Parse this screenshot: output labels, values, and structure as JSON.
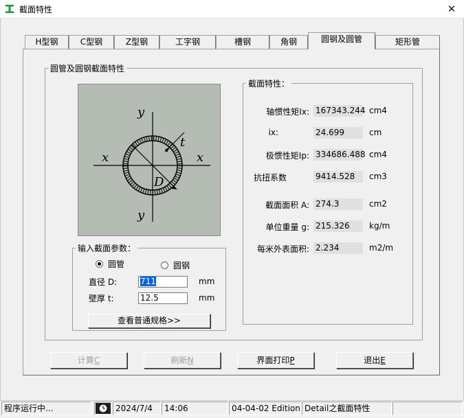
{
  "window": {
    "title": "截面特性",
    "close_symbol": "✕"
  },
  "tabs": [
    {
      "label": "H型钢",
      "active": false
    },
    {
      "label": "C型钢",
      "active": false
    },
    {
      "label": "Z型钢",
      "active": false
    },
    {
      "label": "工字钢",
      "active": false
    },
    {
      "label": "槽钢",
      "active": false
    },
    {
      "label": "角钢",
      "active": false
    },
    {
      "label": "圆钢及圆管",
      "active": true
    },
    {
      "label": "矩形管",
      "active": false
    }
  ],
  "panel": {
    "group_title": "圆管及圆钢截面特性"
  },
  "diagram": {
    "labels": {
      "y": "y",
      "x": "x",
      "t": "t",
      "D": "D"
    }
  },
  "input_params": {
    "title": "输入截面参数：",
    "radio_pipe": {
      "label": "圆管",
      "selected": true
    },
    "radio_bar": {
      "label": "圆钢",
      "selected": false
    },
    "diameter": {
      "label": "直径 D:",
      "value": "711",
      "unit": "mm"
    },
    "thickness": {
      "label": "壁厚 t:",
      "value": "12.5",
      "unit": "mm"
    },
    "spec_button": "查看普通规格>>"
  },
  "properties": {
    "title": "截面特性：",
    "rows": [
      {
        "label": "轴惯性矩Ix:",
        "value": "167343.244",
        "unit": "cm4"
      },
      {
        "label": "ix:",
        "value": "24.699",
        "unit": "cm"
      },
      {
        "label": "极惯性矩Ip:",
        "value": "334686.488",
        "unit": "cm4"
      },
      {
        "label": "抗扭系数",
        "value": "9414.528",
        "unit": "cm3"
      },
      {
        "label": "截面面积 A:",
        "value": "274.3",
        "unit": "cm2"
      },
      {
        "label": "单位重量 g:",
        "value": "215.326",
        "unit": "kg/m"
      },
      {
        "label": "每米外表面积:",
        "value": "2.234",
        "unit": "m2/m"
      }
    ]
  },
  "buttons": {
    "calc": {
      "label": "计算",
      "hotkey": "C",
      "enabled": false
    },
    "refresh": {
      "label": "刷新",
      "hotkey": "N",
      "enabled": false
    },
    "print": {
      "label": "界面打印",
      "hotkey": "P",
      "enabled": true
    },
    "exit": {
      "label": "退出",
      "hotkey": "E",
      "enabled": true
    }
  },
  "statusbar": {
    "status": "程序运行中...",
    "date": "2024/7/4",
    "time": "14:06",
    "edition": "04-04-02 Edition",
    "module": "Detail之截面特性"
  },
  "colors": {
    "accent": "#0a64d8",
    "diagram_bg": "#b4bcb4",
    "value_bg": "#e0e0e0"
  }
}
